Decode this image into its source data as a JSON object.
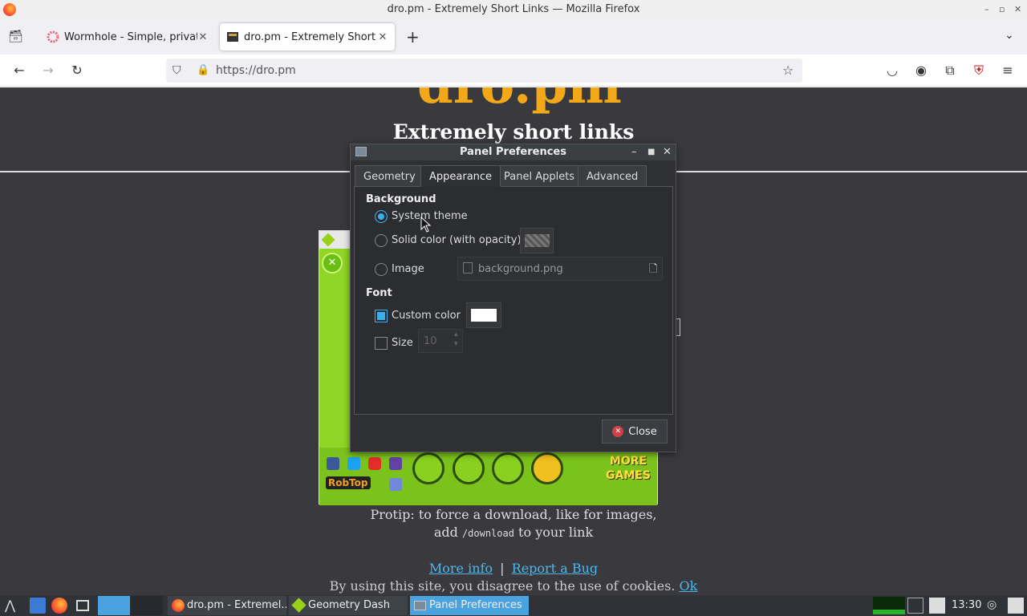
{
  "window": {
    "title": "dro.pm - Extremely Short Links — Mozilla Firefox"
  },
  "tabs": [
    {
      "label": "Wormhole - Simple, privat",
      "close": "✕"
    },
    {
      "label": "dro.pm - Extremely Short l",
      "close": "✕"
    }
  ],
  "toolbar": {
    "new_tab": "+",
    "url": "https://dro.pm"
  },
  "page": {
    "logo": "dro.pm",
    "tagline": "Extremely short links",
    "protip_1": "Protip: to force a download, like for images,",
    "protip_2a": "add ",
    "protip_code": "/download",
    "protip_2b": " to your link",
    "more_info": "More info",
    "separator": "|",
    "report_bug": "Report a Bug",
    "cookie_text": "By using this site, you disagree to the use of cookies.",
    "cookie_ok": "Ok"
  },
  "game": {
    "brand": "RobTop",
    "more_games_1": "MORE",
    "more_games_2": "GAMES"
  },
  "dialog": {
    "title": "Panel Preferences",
    "tabs": [
      "Geometry",
      "Appearance",
      "Panel Applets",
      "Advanced"
    ],
    "background_heading": "Background",
    "opt_system": "System theme",
    "opt_solid": "Solid color (with opacity)",
    "opt_image": "Image",
    "image_file": "background.png",
    "font_heading": "Font",
    "custom_color": "Custom color",
    "size_label": "Size",
    "size_value": "10",
    "close": "Close"
  },
  "taskbar": {
    "items": [
      "dro.pm - Extremel...",
      "Geometry Dash",
      "Panel Preferences"
    ],
    "clock": "13:30"
  },
  "colors": {
    "logo": "#f2a818",
    "link": "#4ab8f0",
    "accent": "#3daee9"
  }
}
